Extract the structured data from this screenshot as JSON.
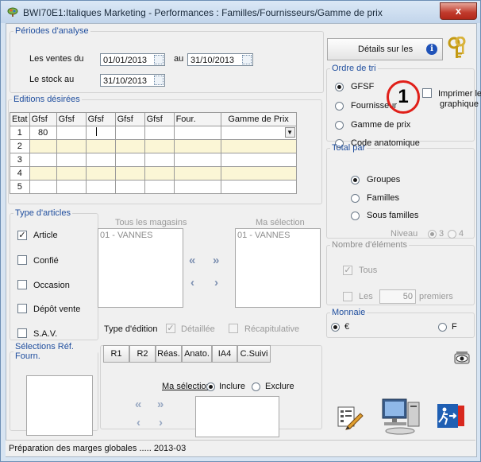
{
  "window": {
    "title": "BWI70E1:Italiques Marketing - Performances : Familles/Fournisseurs/Gamme de prix",
    "close_glyph": "x"
  },
  "periodes": {
    "legend": "Périodes d'analyse",
    "ventes_label": "Les ventes du",
    "ventes_from": "01/01/2013",
    "au_label": "au",
    "ventes_to": "31/10/2013",
    "stock_label": "Le stock au",
    "stock_date": "31/10/2013"
  },
  "editions": {
    "legend": "Editions désirées",
    "columns": [
      "Etat",
      "Gfsf",
      "Gfsf",
      "Gfsf",
      "Gfsf",
      "Gfsf",
      "Four.",
      "Gamme de Prix"
    ],
    "rows": [
      {
        "num": "1",
        "gfsf1": "80"
      },
      {
        "num": "2",
        "gfsf1": ""
      },
      {
        "num": "3",
        "gfsf1": ""
      },
      {
        "num": "4",
        "gfsf1": ""
      },
      {
        "num": "5",
        "gfsf1": ""
      }
    ]
  },
  "details": {
    "button_label": "Détails sur les",
    "info_glyph": "i"
  },
  "ordre_tri": {
    "legend": "Ordre de tri",
    "options": [
      "GFSF",
      "Fournisseur",
      "Gamme de prix",
      "Code anatomique"
    ],
    "selected": 0
  },
  "imprimer": {
    "label_line1": "Imprimer le",
    "label_line2": "graphique",
    "checked": false
  },
  "annotation": {
    "number": "1"
  },
  "total_par": {
    "legend": "Total par",
    "options": [
      "Groupes",
      "Familles",
      "Sous familles"
    ],
    "selected": 0,
    "niveau_label": "Niveau",
    "niveau_options": [
      "3",
      "4"
    ],
    "niveau_selected": 0
  },
  "nombre": {
    "legend": "Nombre d'éléments",
    "tous_label": "Tous",
    "tous_checked": true,
    "les_label": "Les",
    "les_value": "50",
    "premiers_label": "premiers"
  },
  "monnaie": {
    "legend": "Monnaie",
    "options": [
      "€",
      "F"
    ],
    "selected": 0
  },
  "type_articles": {
    "legend": "Type d'articles",
    "options": [
      {
        "label": "Article",
        "checked": true
      },
      {
        "label": "Confié",
        "checked": false
      },
      {
        "label": "Occasion",
        "checked": false
      },
      {
        "label": "Dépôt vente",
        "checked": false
      },
      {
        "label": "S.A.V.",
        "checked": false
      }
    ]
  },
  "magasins": {
    "tous_label": "Tous les magasins",
    "tous_items": [
      "01 - VANNES"
    ],
    "selection_label": "Ma sélection",
    "selection_items": [
      "01 - VANNES"
    ]
  },
  "type_edition": {
    "label": "Type d'édition",
    "detaillee_label": "Détaillée",
    "detaillee_checked": true,
    "recap_label": "Récapitulative",
    "recap_checked": false
  },
  "selections": {
    "legend": "Sélections Réf. Fourn.",
    "tabs": [
      "R1",
      "R2",
      "Réas.",
      "Anato.",
      "IA4",
      "C.Suivi"
    ],
    "ma_selection_label": "Ma sélection",
    "inclure_label": "Inclure",
    "exclure_label": "Exclure",
    "mode_selected": 0
  },
  "status": {
    "text": "Préparation des marges globales ..... 2013-03"
  },
  "colors": {
    "annotation_red": "#e0201a",
    "legend_blue": "#1f4e9e",
    "row_highlight": "#fbf6d6",
    "exit_blue": "#1f5fb3"
  },
  "icons": [
    "app-icon",
    "info-icon",
    "keys-icon",
    "eye-icon",
    "edit-icon",
    "computer-icon",
    "exit-icon"
  ]
}
